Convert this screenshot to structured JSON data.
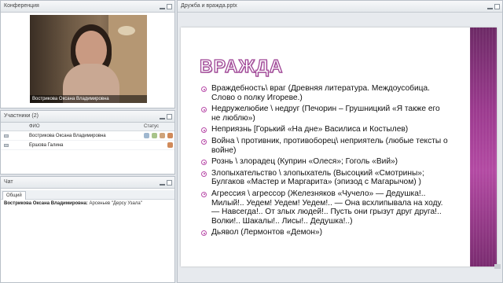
{
  "conference": {
    "title": "Конференция",
    "video_caption": "Вострикова Оксана Владимировна"
  },
  "participants": {
    "title": "Участники (2)",
    "col_name": "ФИО",
    "col_status": "Статус",
    "rows": [
      {
        "name": "Вострикова Оксана Владимировна"
      },
      {
        "name": "Ершова Галина"
      }
    ]
  },
  "chat": {
    "title": "Чат",
    "tab": "Общий",
    "message_author": "Вострикова Оксана Владимировна:",
    "message_text": " Арсеньев \"Дерсу Узала\""
  },
  "document": {
    "title": "Дружба и вражда.pptx",
    "slide_title": "ВРАЖДА",
    "bullets": [
      "Враждебность\\ враг (Древняя литература. Междоусобица. Слово о полку Игореве.)",
      "Недружелюбие \\ недруг (Печорин – Грушницкий «Я также его не люблю»)",
      "Неприязнь  [Горький «На дне» Василиса и Костылев)",
      "Война \\ противник, противоборец\\ неприятель (любые тексты о войне)",
      "Рознь \\ злорадец (Куприн «Олеся»; Гоголь «Вий»)",
      "Злопыхательство \\ злопыхатель (Высоцкий «Смотрины»; Булгаков «Мастер и Маргарита» (эпизод с Магарычом) )",
      "Агрессия \\ агрессор  (Железняков «Чучело» — Дедушка!.. Милый!.. Уедем! Уедем! Уедем!.. — Она всхлипывала на ходу. — Навсегда!.. От злых людей!.. Пусть они грызут друг друга!.. Волки!.. Шакалы!.. Лисы!.. Дедушка!..)",
      "Дьявол  (Лермонтов «Демон»)"
    ]
  },
  "colors": {
    "accent": "#b84aa8",
    "band": "#9c3b8f"
  }
}
